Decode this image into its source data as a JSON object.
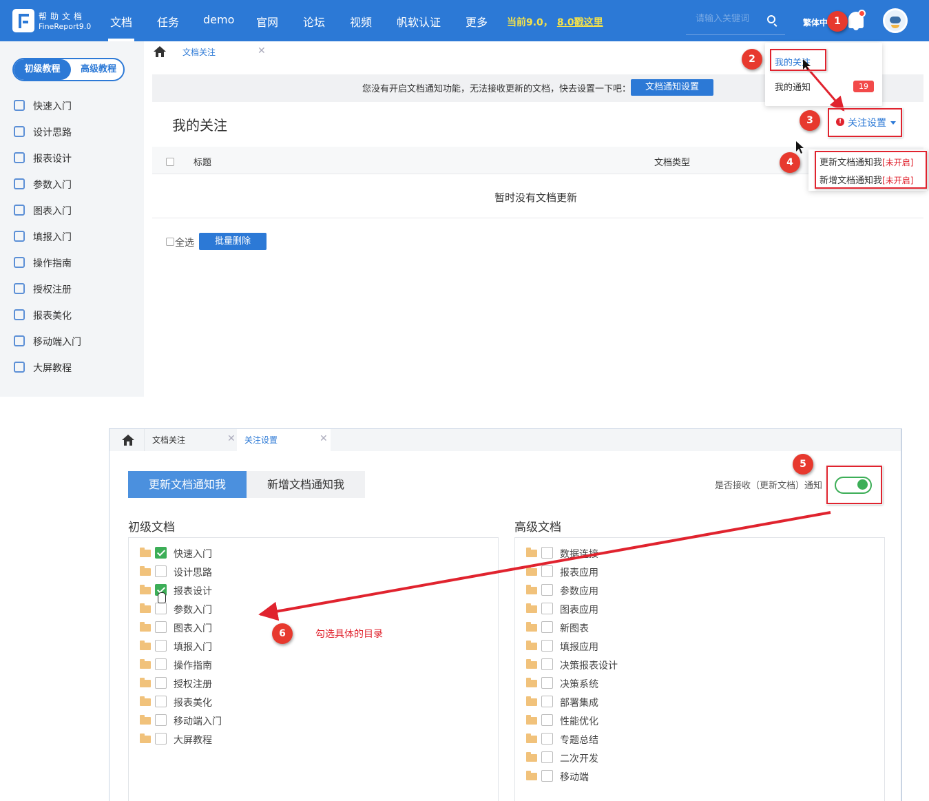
{
  "topbar": {
    "logo_line1": "帮助文档",
    "logo_line2": "FineReport9.0",
    "nav": [
      "文档",
      "任务",
      "demo",
      "官网",
      "论坛",
      "视频",
      "帆软认证",
      "更多"
    ],
    "promo_prefix": "当前9.0，",
    "promo_link": "8.0戳这里",
    "search_placeholder": "请输入关键词",
    "lang": "繁体中"
  },
  "sidebar": {
    "level_tabs": [
      "初级教程",
      "高级教程"
    ],
    "items": [
      "快速入门",
      "设计思路",
      "报表设计",
      "参数入门",
      "图表入门",
      "填报入门",
      "操作指南",
      "授权注册",
      "报表美化",
      "移动端入门",
      "大屏教程"
    ]
  },
  "main": {
    "tab_label": "文档关注",
    "notice_text": "您没有开启文档通知功能，无法接收更新的文档，快去设置一下吧：",
    "notice_button": "文档通知设置",
    "page_title": "我的关注",
    "follow_settings": "关注设置",
    "col_title": "标题",
    "col_type": "文档类型",
    "empty_text": "暂时没有文档更新",
    "select_all": "全选",
    "batch_delete": "批量删除"
  },
  "bell_menu": {
    "my_follow": "我的关注",
    "my_notice": "我的通知",
    "notice_count": "19"
  },
  "settings_menu": {
    "item1": "更新文档通知我",
    "item2": "新增文档通知我",
    "state": "[未开启]"
  },
  "annotations": {
    "numbers": [
      "1",
      "2",
      "3",
      "4",
      "5",
      "6"
    ],
    "step6_text": "勾选具体的目录"
  },
  "panel2": {
    "tabs": [
      "文档关注",
      "关注设置"
    ],
    "segments": [
      "更新文档通知我",
      "新增文档通知我"
    ],
    "receive_label": "是否接收（更新文档）通知",
    "receive_on": true,
    "basic_heading": "初级文档",
    "advanced_heading": "高级文档",
    "basic_items": [
      {
        "label": "快速入门",
        "checked": true
      },
      {
        "label": "设计思路",
        "checked": false
      },
      {
        "label": "报表设计",
        "checked": true
      },
      {
        "label": "参数入门",
        "checked": false
      },
      {
        "label": "图表入门",
        "checked": false
      },
      {
        "label": "填报入门",
        "checked": false
      },
      {
        "label": "操作指南",
        "checked": false
      },
      {
        "label": "授权注册",
        "checked": false
      },
      {
        "label": "报表美化",
        "checked": false
      },
      {
        "label": "移动端入门",
        "checked": false
      },
      {
        "label": "大屏教程",
        "checked": false
      }
    ],
    "advanced_items": [
      {
        "label": "数据连接",
        "checked": false
      },
      {
        "label": "报表应用",
        "checked": false
      },
      {
        "label": "参数应用",
        "checked": false
      },
      {
        "label": "图表应用",
        "checked": false
      },
      {
        "label": "新图表",
        "checked": false
      },
      {
        "label": "填报应用",
        "checked": false
      },
      {
        "label": "决策报表设计",
        "checked": false
      },
      {
        "label": "决策系统",
        "checked": false
      },
      {
        "label": "部署集成",
        "checked": false
      },
      {
        "label": "性能优化",
        "checked": false
      },
      {
        "label": "专题总结",
        "checked": false
      },
      {
        "label": "二次开发",
        "checked": false
      },
      {
        "label": "移动端",
        "checked": false
      }
    ]
  }
}
